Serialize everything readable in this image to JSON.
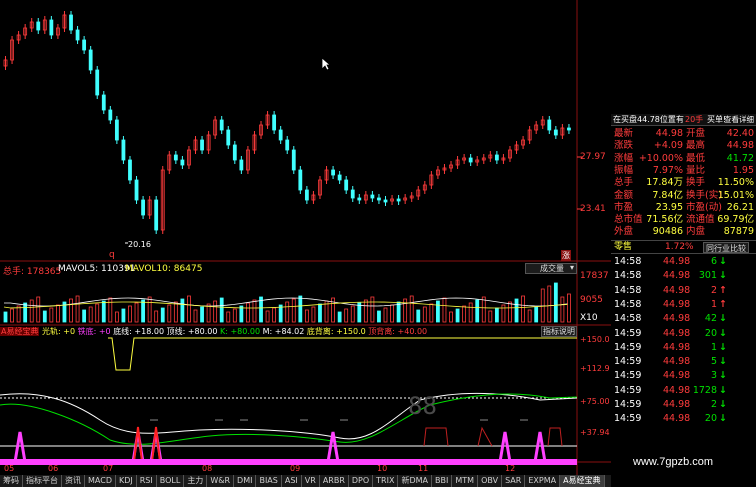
{
  "kline": {
    "prices": {
      "high": "27.97",
      "low": "23.41",
      "low_mark": "20.16"
    },
    "q_label": "q",
    "flag_label": "涨"
  },
  "volume": {
    "header": {
      "total": "总手: 178365",
      "mavol5": "MAVOL5: 110391",
      "mavol10": "MAVOL10: 86475"
    },
    "dropdown": "成交量",
    "axis": {
      "top": "17837",
      "mid": "9055",
      "unit": "X10"
    }
  },
  "indicator": {
    "header_items": [
      "A易经宝典",
      "光轨: +0",
      "铁底: +0",
      "底线: +18.00",
      "顶线: +80.00",
      "K: +80.00",
      "M: +84.02",
      "底背离: +150.0",
      "顶背离: +40.00"
    ],
    "help_button": "指标说明",
    "axis": [
      "+150.0",
      "+112.9",
      "+75.00",
      "+37.94"
    ],
    "watermark": "88"
  },
  "x_axis": [
    "05",
    "06",
    "07",
    "08",
    "09",
    "10",
    "11",
    "12"
  ],
  "tabs": [
    "筹码",
    "指标平台",
    "资讯",
    "MACD",
    "KDJ",
    "RSI",
    "BOLL",
    "主力",
    "W&R",
    "DMI",
    "BIAS",
    "ASI",
    "VR",
    "ARBR",
    "DPO",
    "TRIX",
    "新DMA",
    "BBI",
    "MTM",
    "OBV",
    "SAR",
    "EXPMA",
    "A易经宝典"
  ],
  "quote": {
    "top_bar": {
      "buy_text": "在买盘44.78位置有",
      "lots": "20手",
      "buy1": "买单!",
      "detail": "查看详细"
    },
    "rows": [
      {
        "l1": "最新",
        "v1": "44.98",
        "l2": "开盘",
        "v2": "42.40"
      },
      {
        "l1": "涨跌",
        "v1": "+4.09",
        "l2": "最高",
        "v2": "44.98"
      },
      {
        "l1": "涨幅",
        "v1": "+10.00%",
        "l2": "最低",
        "v2": "41.72"
      },
      {
        "l1": "振幅",
        "v1": "7.97%",
        "l2": "量比",
        "v2": "1.95"
      },
      {
        "l1": "总手",
        "v1": "17.84万",
        "l2": "换手",
        "v2": "11.50%"
      },
      {
        "l1": "金额",
        "v1": "7.84亿",
        "l2": "换手(实)",
        "v2": "15.01%"
      },
      {
        "l1": "市盈",
        "v1": "23.95",
        "l2": "市盈(动)",
        "v2": "26.21"
      },
      {
        "l1": "总市值",
        "v1": "71.56亿",
        "l2": "流通值",
        "v2": "69.79亿"
      },
      {
        "l1": "外盘",
        "v1": "90486",
        "l2": "内盘",
        "v2": "87879"
      }
    ],
    "sector": {
      "name": "零售",
      "pct": "1.72%",
      "button": "同行业比较"
    },
    "trades": [
      {
        "time": "14:58",
        "price": "44.98",
        "vol": "6",
        "dir": "down"
      },
      {
        "time": "14:58",
        "price": "44.98",
        "vol": "301",
        "dir": "down"
      },
      {
        "time": "14:58",
        "price": "44.98",
        "vol": "2",
        "dir": "up"
      },
      {
        "time": "14:58",
        "price": "44.98",
        "vol": "1",
        "dir": "up"
      },
      {
        "time": "14:58",
        "price": "44.98",
        "vol": "42",
        "dir": "down"
      },
      {
        "time": "14:59",
        "price": "44.98",
        "vol": "20",
        "dir": "down"
      },
      {
        "time": "14:59",
        "price": "44.98",
        "vol": "1",
        "dir": "down"
      },
      {
        "time": "14:59",
        "price": "44.98",
        "vol": "5",
        "dir": "down"
      },
      {
        "time": "14:59",
        "price": "44.98",
        "vol": "3",
        "dir": "down"
      },
      {
        "time": "14:59",
        "price": "44.98",
        "vol": "1728",
        "dir": "down"
      },
      {
        "time": "14:59",
        "price": "44.98",
        "vol": "2",
        "dir": "down"
      },
      {
        "time": "14:59",
        "price": "44.98",
        "vol": "20",
        "dir": "down"
      }
    ],
    "watermark": "www.7gpzb.com"
  },
  "colors": {
    "up": "#ff3c3c",
    "down": "#40ffff",
    "green": "#00e000",
    "yellow": "#ffff40",
    "magenta": "#ff40ff"
  }
}
